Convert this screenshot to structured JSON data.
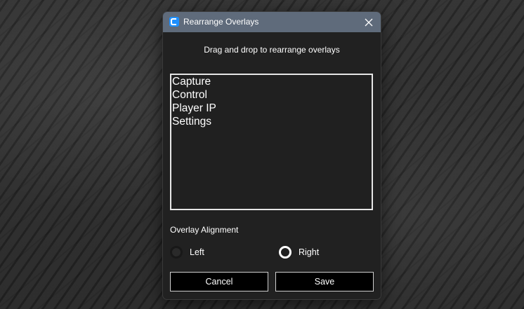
{
  "window": {
    "title": "Rearrange Overlays",
    "icon": "app-icon",
    "close_icon": "close-icon"
  },
  "instructions": "Drag and drop to rearrange overlays",
  "overlays": {
    "items": [
      {
        "label": "Capture"
      },
      {
        "label": "Control"
      },
      {
        "label": "Player IP"
      },
      {
        "label": "Settings"
      }
    ]
  },
  "alignment": {
    "label": "Overlay Alignment",
    "options": [
      {
        "label": "Left",
        "selected": false
      },
      {
        "label": "Right",
        "selected": true
      }
    ]
  },
  "buttons": {
    "cancel": "Cancel",
    "save": "Save"
  },
  "colors": {
    "titlebar": "#5f6b7b",
    "dialog_bg": "#212121",
    "accent_icon": "#1e90ff"
  }
}
